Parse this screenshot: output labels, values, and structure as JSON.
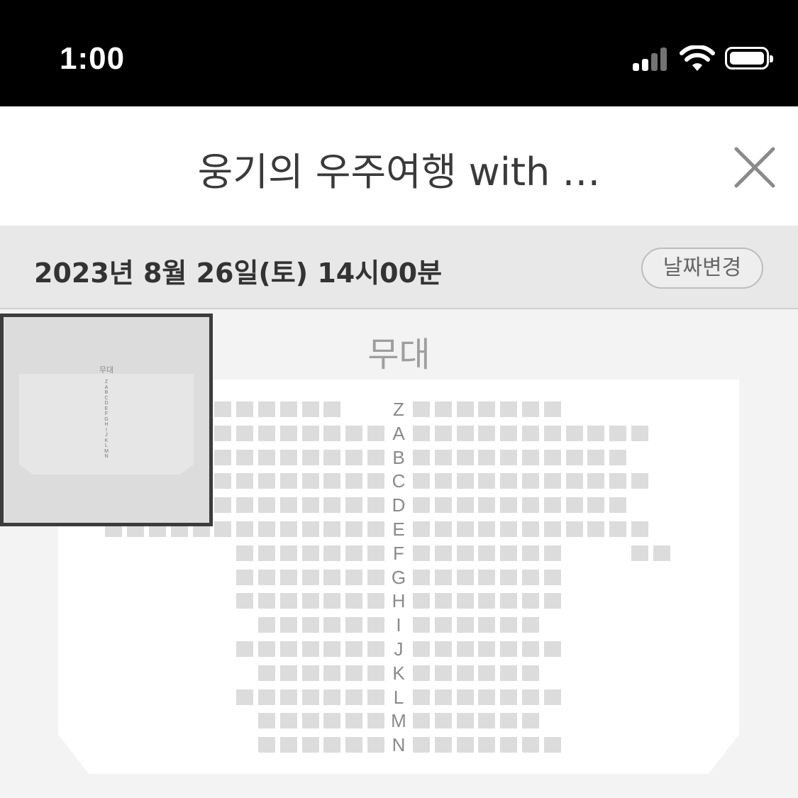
{
  "status_bar": {
    "time": "1:00"
  },
  "header": {
    "title": "웅기의 우주여행 with …"
  },
  "date_bar": {
    "date_text": "2023년 8월 26일(토) 14시00분",
    "change_button": "날짜변경"
  },
  "stage_label": "무대",
  "minimap": {
    "stage_label": "무대",
    "rows": [
      "Z",
      "A",
      "B",
      "C",
      "D",
      "E",
      "F",
      "G",
      "H",
      "I",
      "J",
      "K",
      "L",
      "M",
      "N"
    ]
  },
  "seat_rows": [
    {
      "label": "Z",
      "left": [
        2,
        3,
        4,
        5,
        6,
        7
      ],
      "right": [
        0,
        1,
        2,
        3,
        4,
        5,
        6
      ]
    },
    {
      "label": "A",
      "left": [
        0,
        1,
        2,
        3,
        4,
        5,
        6,
        7
      ],
      "right": [
        0,
        1,
        2,
        3,
        4,
        5,
        6,
        7,
        8,
        9,
        10
      ]
    },
    {
      "label": "B",
      "left": [
        0,
        1,
        2,
        3,
        4,
        5,
        6,
        7
      ],
      "right": [
        0,
        1,
        2,
        3,
        4,
        5,
        6,
        7,
        8,
        9
      ]
    },
    {
      "label": "C",
      "left": [
        0,
        1,
        2,
        3,
        4,
        5,
        6,
        7
      ],
      "right": [
        0,
        1,
        2,
        3,
        4,
        5,
        6,
        7,
        8,
        9,
        10
      ]
    },
    {
      "label": "D",
      "left": [
        0,
        1,
        2,
        3,
        4,
        5,
        6,
        7
      ],
      "right": [
        0,
        1,
        2,
        3,
        4,
        5,
        6,
        7,
        8,
        9
      ]
    },
    {
      "label": "E",
      "left": [
        0,
        1,
        2,
        3,
        4,
        5,
        6,
        7,
        8,
        9,
        10,
        11,
        12
      ],
      "right": [
        0,
        1,
        2,
        3,
        4,
        5,
        6,
        7,
        8,
        9,
        10
      ]
    },
    {
      "label": "F",
      "left": [
        0,
        1,
        2,
        3,
        4,
        5,
        6
      ],
      "right": [
        0,
        1,
        2,
        3,
        4,
        5,
        6,
        10,
        11
      ]
    },
    {
      "label": "G",
      "left": [
        0,
        1,
        2,
        3,
        4,
        5,
        6
      ],
      "right": [
        0,
        1,
        2,
        3,
        4,
        5,
        6
      ]
    },
    {
      "label": "H",
      "left": [
        0,
        1,
        2,
        3,
        4,
        5,
        6
      ],
      "right": [
        0,
        1,
        2,
        3,
        4,
        5,
        6
      ]
    },
    {
      "label": "I",
      "left": [
        0,
        1,
        2,
        3,
        4,
        5
      ],
      "right": [
        0,
        1,
        2,
        3,
        4,
        5
      ]
    },
    {
      "label": "J",
      "left": [
        0,
        1,
        2,
        3,
        4,
        5,
        6
      ],
      "right": [
        0,
        1,
        2,
        3,
        4,
        5,
        6
      ]
    },
    {
      "label": "K",
      "left": [
        0,
        1,
        2,
        3,
        4,
        5
      ],
      "right": [
        0,
        1,
        2,
        3,
        4,
        5
      ]
    },
    {
      "label": "L",
      "left": [
        0,
        1,
        2,
        3,
        4,
        5,
        6
      ],
      "right": [
        0,
        1,
        2,
        3,
        4,
        5,
        6
      ]
    },
    {
      "label": "M",
      "left": [
        0,
        1,
        2,
        3,
        4,
        5
      ],
      "right": [
        0,
        1,
        2,
        3,
        4,
        5
      ]
    },
    {
      "label": "N",
      "left": [
        0,
        1,
        2,
        3,
        4,
        5
      ],
      "right": [
        0,
        1,
        2,
        3,
        4,
        5,
        6
      ]
    }
  ]
}
